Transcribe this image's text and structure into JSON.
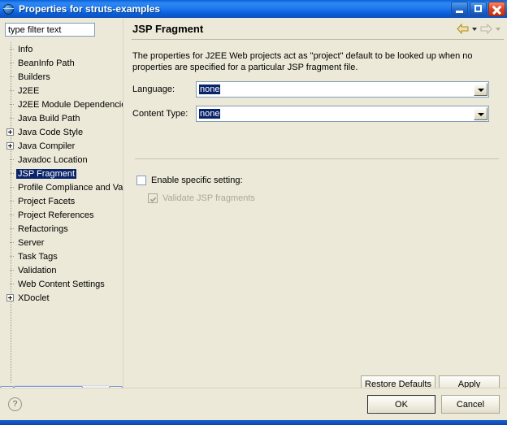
{
  "window": {
    "title": "Properties for struts-examples",
    "icon": "eclipse-globe-icon",
    "controls": {
      "minimize": "minimize-button",
      "maximize": "maximize-button",
      "close": "close-button"
    }
  },
  "sidebar": {
    "filter": {
      "placeholder": "type filter text",
      "value": ""
    },
    "items": [
      {
        "label": "Info",
        "expandable": false,
        "selected": false
      },
      {
        "label": "BeanInfo Path",
        "expandable": false,
        "selected": false
      },
      {
        "label": "Builders",
        "expandable": false,
        "selected": false
      },
      {
        "label": "J2EE",
        "expandable": false,
        "selected": false
      },
      {
        "label": "J2EE Module Dependencie",
        "expandable": false,
        "selected": false
      },
      {
        "label": "Java Build Path",
        "expandable": false,
        "selected": false
      },
      {
        "label": "Java Code Style",
        "expandable": true,
        "selected": false
      },
      {
        "label": "Java Compiler",
        "expandable": true,
        "selected": false
      },
      {
        "label": "Javadoc Location",
        "expandable": false,
        "selected": false
      },
      {
        "label": "JSP Fragment",
        "expandable": false,
        "selected": true
      },
      {
        "label": "Profile Compliance and Va",
        "expandable": false,
        "selected": false
      },
      {
        "label": "Project Facets",
        "expandable": false,
        "selected": false
      },
      {
        "label": "Project References",
        "expandable": false,
        "selected": false
      },
      {
        "label": "Refactorings",
        "expandable": false,
        "selected": false
      },
      {
        "label": "Server",
        "expandable": false,
        "selected": false
      },
      {
        "label": "Task Tags",
        "expandable": false,
        "selected": false
      },
      {
        "label": "Validation",
        "expandable": false,
        "selected": false
      },
      {
        "label": "Web Content Settings",
        "expandable": false,
        "selected": false
      },
      {
        "label": "XDoclet",
        "expandable": true,
        "selected": false
      }
    ],
    "scrollbar": {
      "left_arrow": "scroll-left-icon",
      "right_arrow": "scroll-right-icon"
    }
  },
  "page": {
    "title": "JSP Fragment",
    "nav": {
      "back_icon": "back-arrow-icon",
      "back_menu_icon": "back-dropdown-icon",
      "forward_icon": "forward-arrow-icon",
      "forward_menu_icon": "forward-dropdown-icon"
    },
    "description": "The properties for J2EE Web projects act as \"project\" default to be looked up when no properties are specified for a particular JSP fragment file.",
    "fields": [
      {
        "label": "Language:",
        "value": "none",
        "dropdown_icon": "chevron-down-icon"
      },
      {
        "label": "Content Type:",
        "value": "none",
        "dropdown_icon": "chevron-down-icon"
      }
    ],
    "checkboxes": [
      {
        "label": "Enable specific setting:",
        "checked": false,
        "disabled": false
      },
      {
        "label": "Validate JSP fragments",
        "checked": true,
        "disabled": true
      }
    ],
    "buttons": {
      "restore_defaults": "Restore Defaults",
      "apply": "Apply"
    }
  },
  "footer": {
    "help_icon": "help-question-icon",
    "ok": "OK",
    "cancel": "Cancel"
  },
  "colors": {
    "titlebar_blue": "#1B74E8",
    "dialog_bg": "#ECE9D8",
    "selection_blue": "#0A246A",
    "field_border": "#7F9DB9",
    "disabled_text": "#ACA899"
  }
}
